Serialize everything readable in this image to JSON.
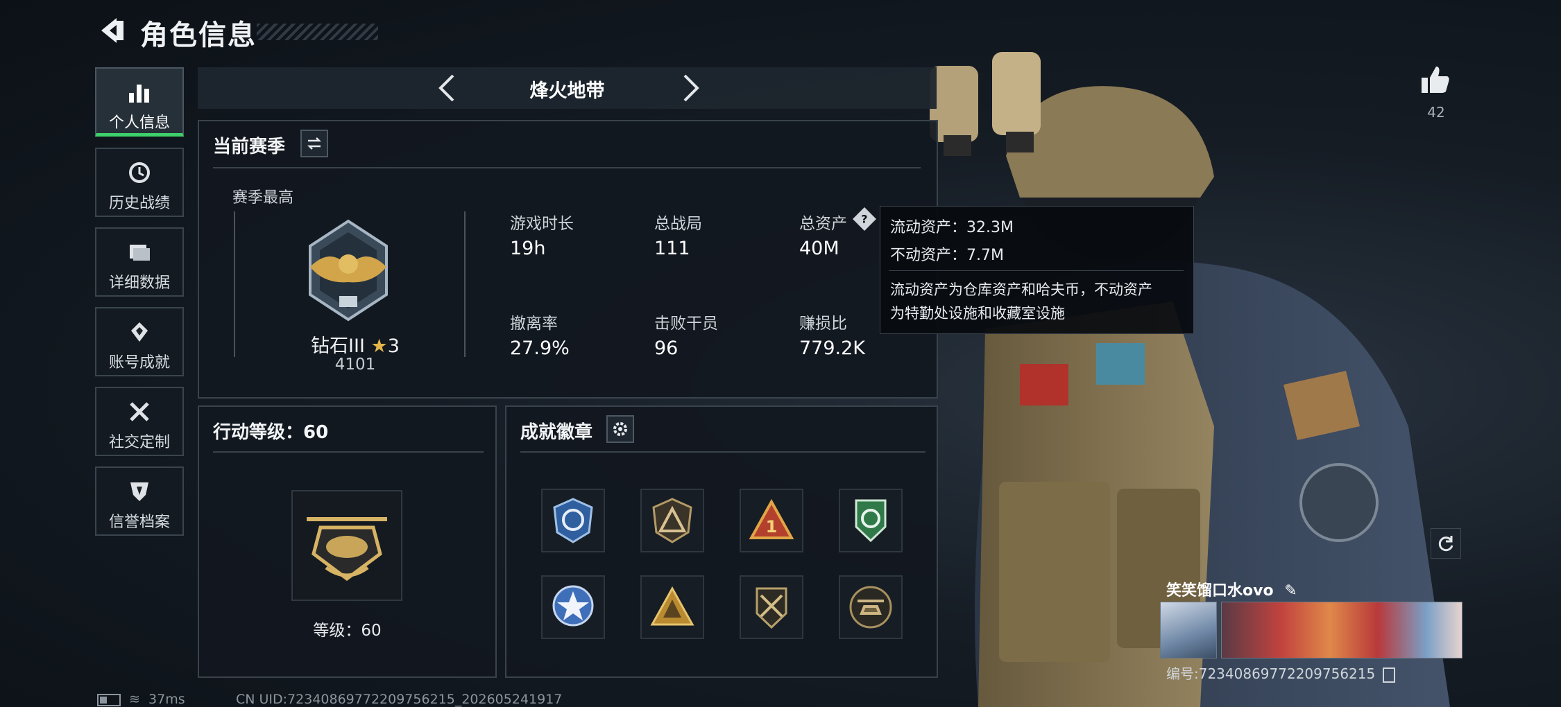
{
  "header": {
    "title": "角色信息"
  },
  "sidebar": {
    "items": [
      {
        "label": "个人信息",
        "icon": "bar-chart-icon",
        "active": true
      },
      {
        "label": "历史战绩",
        "icon": "history-icon",
        "active": false
      },
      {
        "label": "详细数据",
        "icon": "folder-icon",
        "active": false
      },
      {
        "label": "账号成就",
        "icon": "achievement-icon",
        "active": false
      },
      {
        "label": "社交定制",
        "icon": "tools-icon",
        "active": false
      },
      {
        "label": "信誉档案",
        "icon": "shield-icon",
        "active": false
      }
    ]
  },
  "mode": {
    "label": "烽火地带"
  },
  "season": {
    "title": "当前赛季",
    "best_label": "赛季最高",
    "rank_name": "钻石III",
    "rank_stars": "3",
    "rank_points": "4101",
    "stats": [
      {
        "label": "游戏时长",
        "value": "19h"
      },
      {
        "label": "总战局",
        "value": "111"
      },
      {
        "label": "总资产",
        "value": "40M"
      },
      {
        "label": "撤离率",
        "value": "27.9%"
      },
      {
        "label": "击败干员",
        "value": "96"
      },
      {
        "label": "赚损比",
        "value": "779.2K"
      }
    ]
  },
  "tooltip": {
    "line1": "流动资产：32.3M",
    "line2": "不动资产：7.7M",
    "desc1": "流动资产为仓库资产和哈夫币，不动资产",
    "desc2": "为特勤处设施和收藏室设施"
  },
  "action_level": {
    "title": "行动等级：60",
    "caption": "等级：60"
  },
  "achievements": {
    "title": "成就徽章",
    "badges": [
      {
        "icon": "blue-globe-badge-icon",
        "color": "#3b6fb6"
      },
      {
        "icon": "triangle-badge-icon",
        "color": "#a88a5a"
      },
      {
        "icon": "red-triangle-one-badge-icon",
        "color": "#c9952e"
      },
      {
        "icon": "green-shield-badge-icon",
        "color": "#3e9a5a"
      },
      {
        "icon": "blue-star-badge-icon",
        "color": "#5b8fd9"
      },
      {
        "icon": "pyramid-badge-icon",
        "color": "#c49a3a"
      },
      {
        "icon": "crossed-rifle-badge-icon",
        "color": "#9d8a57"
      },
      {
        "icon": "helicopter-badge-icon",
        "color": "#8c7a56"
      }
    ]
  },
  "profile": {
    "likes": "42",
    "nickname": "笑笑馏口水ovo",
    "player_id": "编号:72340869772209756215"
  },
  "status": {
    "ping": "37ms",
    "uid": "CN UID:72340869772209756215_202605241917"
  },
  "colors": {
    "accent_green": "#3ed06a",
    "panel_border": "#3a434c"
  }
}
